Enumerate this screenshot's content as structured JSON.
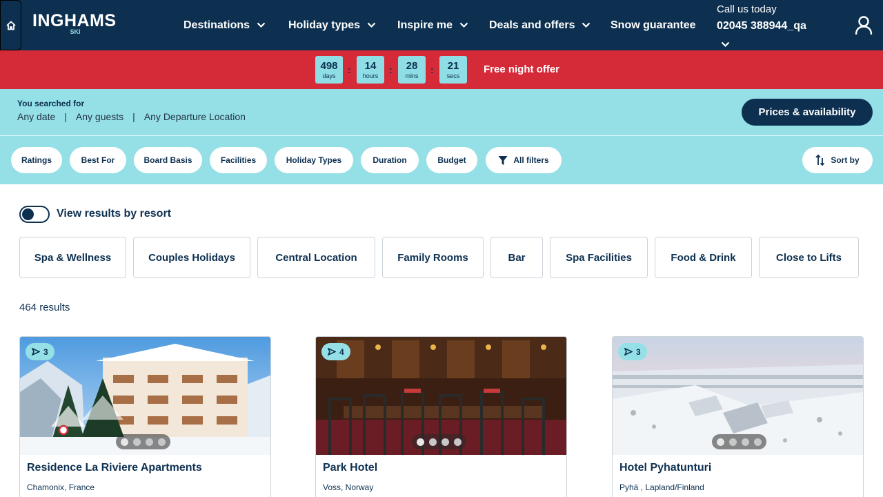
{
  "header": {
    "home_icon": "home-icon",
    "logo_text": "INGHAMS",
    "logo_sub": "SKI",
    "nav": [
      {
        "label": "Destinations",
        "has_dropdown": true
      },
      {
        "label": "Holiday types",
        "has_dropdown": true
      },
      {
        "label": "Inspire me",
        "has_dropdown": true
      },
      {
        "label": "Deals and offers",
        "has_dropdown": true
      },
      {
        "label": "Snow guarantee",
        "has_dropdown": false
      }
    ],
    "call_label": "Call us today",
    "call_number": "02045 388944_qa",
    "user_icon": "user-icon"
  },
  "offer": {
    "countdown": [
      {
        "value": "498",
        "unit": "days"
      },
      {
        "value": "14",
        "unit": "hours"
      },
      {
        "value": "28",
        "unit": "mins"
      },
      {
        "value": "21",
        "unit": "secs"
      }
    ],
    "text": "Free night offer"
  },
  "search": {
    "label": "You searched for",
    "date": "Any date",
    "guests": "Any guests",
    "departure": "Any Departure Location",
    "prices_button": "Prices & availability"
  },
  "filters": {
    "pills": [
      "Ratings",
      "Best For",
      "Board Basis",
      "Facilities",
      "Holiday Types",
      "Duration",
      "Budget"
    ],
    "all_filters": "All filters",
    "sort_by": "Sort by"
  },
  "toggle": {
    "label": "View results by resort",
    "on": false
  },
  "quick_tags": [
    "Spa & Wellness",
    "Couples Holidays",
    "Central Location",
    "Family Rooms",
    "Bar",
    "Spa Facilities",
    "Food & Drink",
    "Close to Lifts"
  ],
  "results_count": "464 results",
  "cards": [
    {
      "rating": "3",
      "title": "Residence La Riviere Apartments",
      "location": "Chamonix, France",
      "image_dots": 4
    },
    {
      "rating": "4",
      "title": "Park Hotel",
      "location": "Voss, Norway",
      "image_dots": 4
    },
    {
      "rating": "3",
      "title": "Hotel Pyhatunturi",
      "location": "Pyhä , Lapland/Finland",
      "image_dots": 4
    }
  ],
  "colors": {
    "navy": "#0d3050",
    "aqua": "#95e0e7",
    "red": "#d52b38"
  }
}
